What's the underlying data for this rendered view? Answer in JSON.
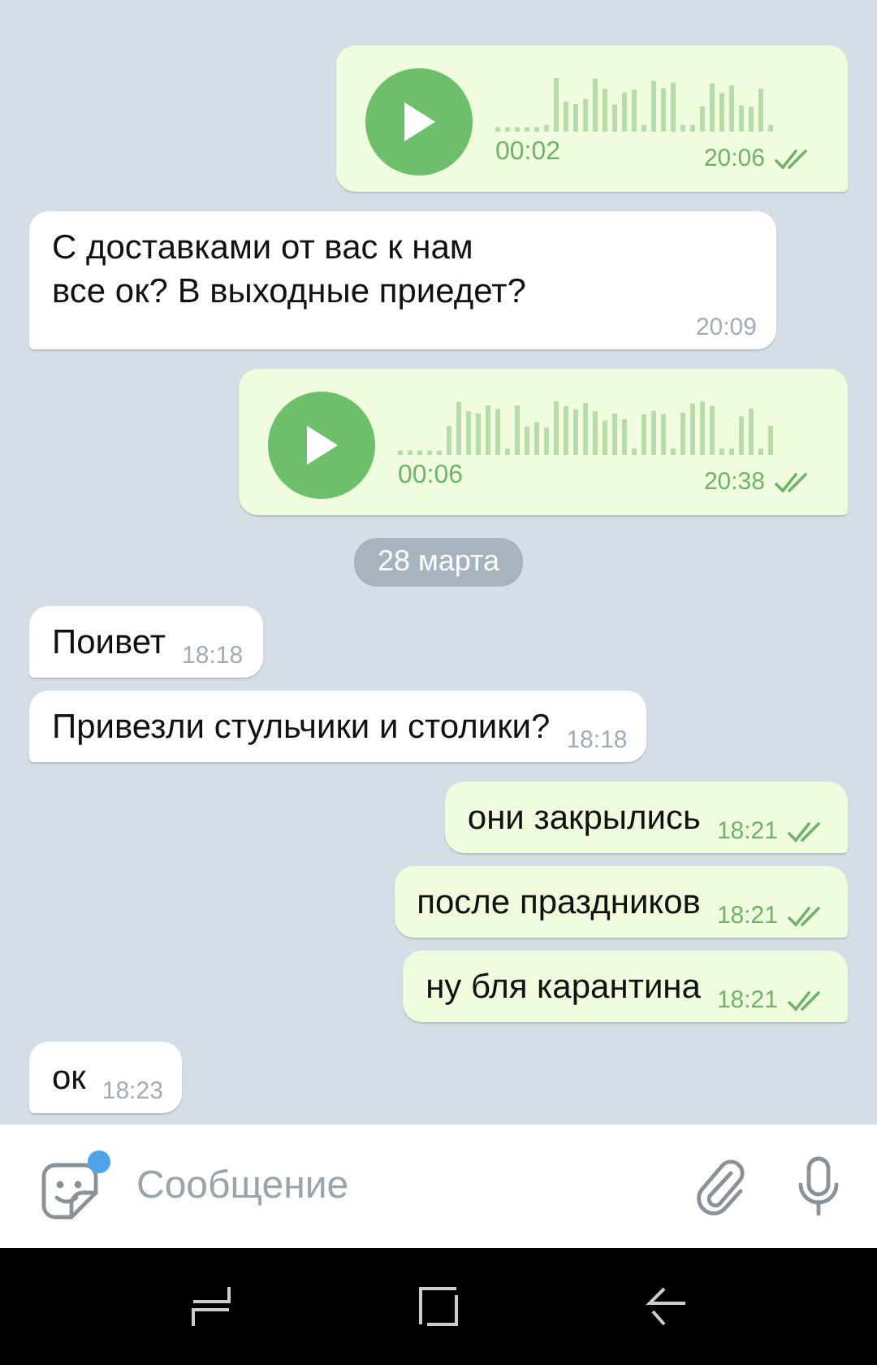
{
  "messages": [
    {
      "kind": "voice",
      "outgoing": true,
      "duration": "00:02",
      "time": "20:06",
      "read": true
    },
    {
      "kind": "text",
      "outgoing": false,
      "text": "С доставками от вас к нам все ок? В выходные приедет?",
      "time": "20:09"
    },
    {
      "kind": "voice",
      "outgoing": true,
      "duration": "00:06",
      "time": "20:38",
      "read": true
    },
    {
      "kind": "date",
      "text": "28 марта"
    },
    {
      "kind": "text",
      "outgoing": false,
      "text": "Поивет",
      "time": "18:18"
    },
    {
      "kind": "text",
      "outgoing": false,
      "text": "Привезли стульчики и столики?",
      "time": "18:18"
    },
    {
      "kind": "text",
      "outgoing": true,
      "text": "они закрылись",
      "time": "18:21",
      "read": true
    },
    {
      "kind": "text",
      "outgoing": true,
      "text": "после праздников",
      "time": "18:21",
      "read": true
    },
    {
      "kind": "text",
      "outgoing": true,
      "text": "ну бля карантина",
      "time": "18:21",
      "read": true
    },
    {
      "kind": "text",
      "outgoing": false,
      "text": "ок",
      "time": "18:23"
    }
  ],
  "composer": {
    "placeholder": "Сообщение",
    "sticker_badge": true
  }
}
